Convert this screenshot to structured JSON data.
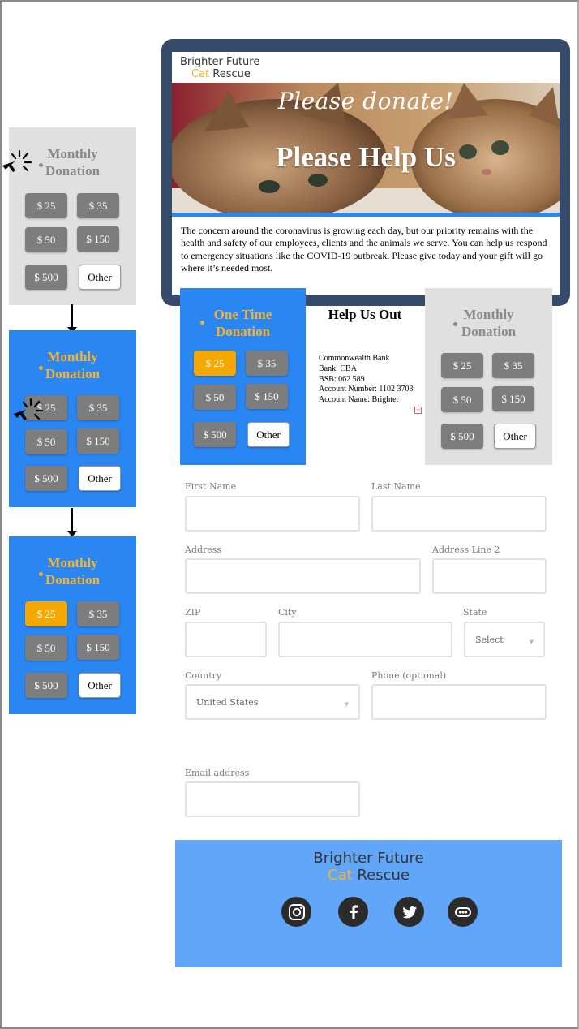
{
  "storyboard": {
    "card1": {
      "title": "Monthly Donation",
      "amounts": [
        "$ 25",
        "$ 35",
        "$ 50",
        "$ 150",
        "$ 500"
      ],
      "other": "Other"
    },
    "card2": {
      "title": "Monthly Donation",
      "amounts": [
        "$ 25",
        "$ 35",
        "$ 50",
        "$ 150",
        "$ 500"
      ],
      "other": "Other"
    },
    "card3": {
      "title": "Monthly Donation",
      "amounts": [
        "$ 25",
        "$ 35",
        "$ 50",
        "$ 150",
        "$ 500"
      ],
      "other": "Other",
      "selected": "$ 25"
    }
  },
  "hero": {
    "brand_line1": "Brighter Future",
    "brand_cat": "Cat",
    "brand_rescue": "Rescue",
    "script": "Please donate!",
    "title": "Please Help Us",
    "text": "The concern around the coronavirus is growing each day, but our priority remains with the health and safety of our employees, clients and the animals we serve. You can help us respond to emergency situations like the COVID-19 outbreak. Please give today and your gift will go where it’s needed most."
  },
  "donation": {
    "one_time": {
      "title": "One Time Donation",
      "amounts": [
        "$ 25",
        "$ 35",
        "$ 50",
        "$ 150",
        "$ 500"
      ],
      "other": "Other",
      "selected": "$ 25"
    },
    "help": {
      "title": "Help Us Out",
      "bank_lines": [
        "Commonwealth Bank",
        "Bank: CBA",
        "BSB: 062 589",
        "Account Number: 1102 3703",
        "Account Name: Brighter"
      ]
    },
    "monthly": {
      "title": "Monthly Donation",
      "amounts": [
        "$ 25",
        "$ 35",
        "$ 50",
        "$ 150",
        "$ 500"
      ],
      "other": "Other"
    }
  },
  "form": {
    "first_name": "First Name",
    "last_name": "Last Name",
    "address": "Address",
    "address2": "Address Line 2",
    "zip": "ZIP",
    "city": "City",
    "state": "State",
    "state_value": "Select",
    "country": "Country",
    "country_value": "United States",
    "phone": "Phone (optional)",
    "email": "Email address"
  },
  "footer": {
    "brand_line1": "Brighter Future",
    "brand_cat": "Cat",
    "brand_rescue": "Rescue",
    "social_icons": [
      "instagram-icon",
      "facebook-icon",
      "twitter-icon",
      "more-icon"
    ]
  },
  "colors": {
    "accent_blue": "#2a86f2",
    "footer_blue": "#62a6fa",
    "selected_gold": "#f5a900",
    "title_gold": "#f5b32c",
    "hero_frame": "#354b69"
  }
}
